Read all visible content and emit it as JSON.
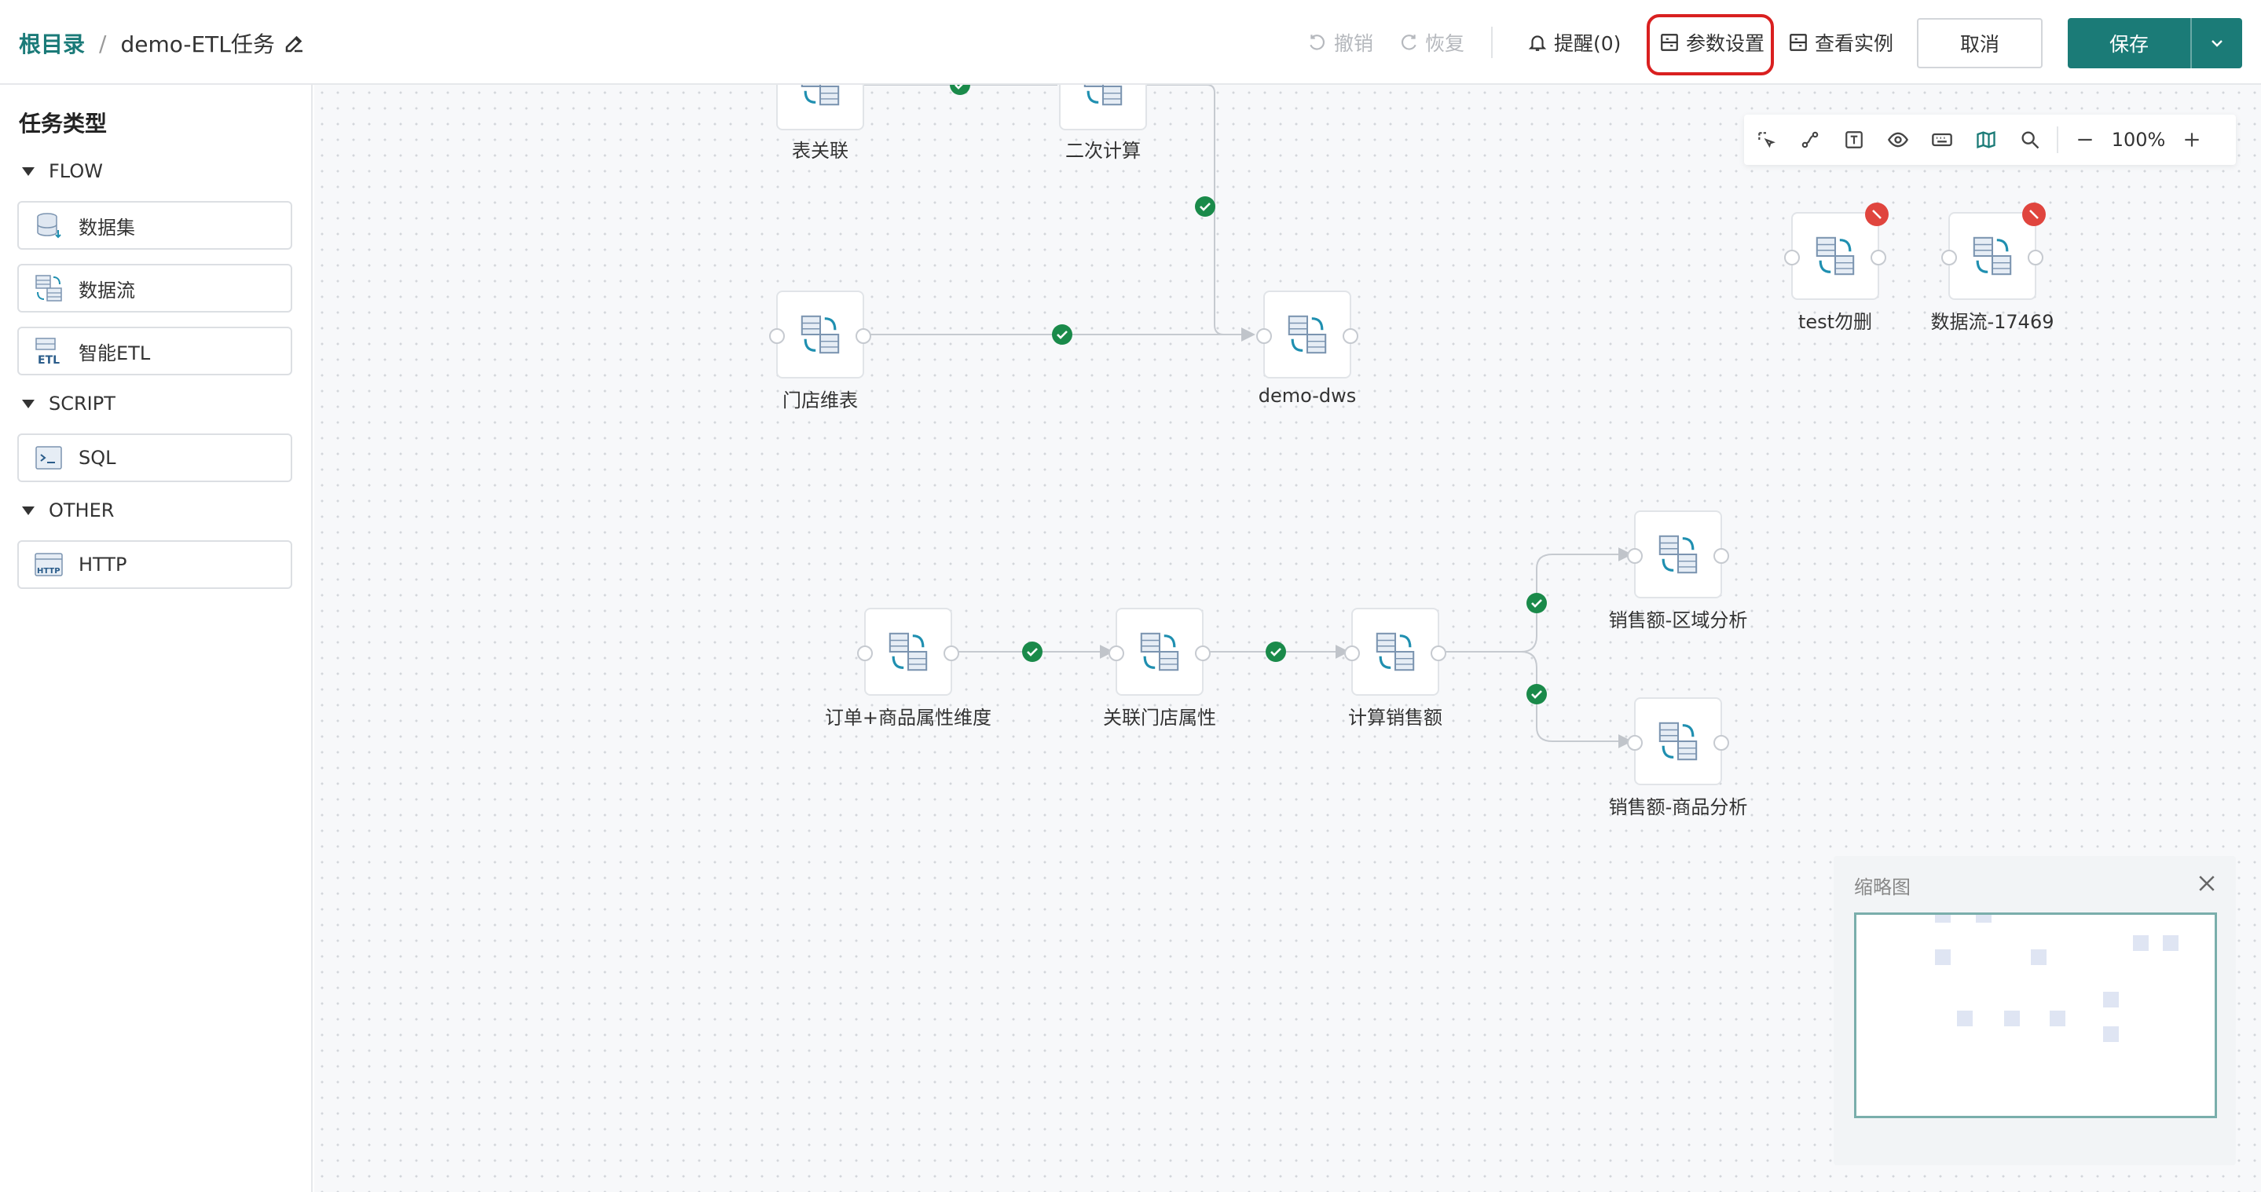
{
  "header": {
    "breadcrumb_root": "根目录",
    "breadcrumb_sep": "/",
    "task_name": "demo-ETL任务",
    "undo_label": "撤销",
    "redo_label": "恢复",
    "remind_label": "提醒(0)",
    "params_label": "参数设置",
    "instances_label": "查看实例",
    "cancel_label": "取消",
    "save_label": "保存"
  },
  "sidebar": {
    "title": "任务类型",
    "groups": [
      {
        "label": "FLOW",
        "items": [
          {
            "label": "数据集",
            "icon": "dataset-icon"
          },
          {
            "label": "数据流",
            "icon": "dataflow-icon"
          },
          {
            "label": "智能ETL",
            "icon": "etl-icon"
          }
        ]
      },
      {
        "label": "SCRIPT",
        "items": [
          {
            "label": "SQL",
            "icon": "sql-icon"
          }
        ]
      },
      {
        "label": "OTHER",
        "items": [
          {
            "label": "HTTP",
            "icon": "http-icon"
          }
        ]
      }
    ]
  },
  "canvas": {
    "nodes": [
      {
        "label": "表关联"
      },
      {
        "label": "二次计算"
      },
      {
        "label": "门店维表"
      },
      {
        "label": "demo-dws"
      },
      {
        "label": "test勿删",
        "status": "error"
      },
      {
        "label": "数据流-17469",
        "status": "error"
      },
      {
        "label": "订单+商品属性维度"
      },
      {
        "label": "关联门店属性"
      },
      {
        "label": "计算销售额"
      },
      {
        "label": "销售额-区域分析"
      },
      {
        "label": "销售额-商品分析"
      }
    ]
  },
  "toolbar": {
    "zoom": "100%",
    "tools": [
      "select-icon",
      "connect-icon",
      "text-icon",
      "eye-icon",
      "keyboard-icon",
      "map-icon",
      "search-icon"
    ]
  },
  "minimap": {
    "title": "缩略图"
  },
  "colors": {
    "brand": "#1b7b77",
    "success": "#1a8a4a",
    "error": "#e0453e",
    "highlight": "#d92020"
  }
}
